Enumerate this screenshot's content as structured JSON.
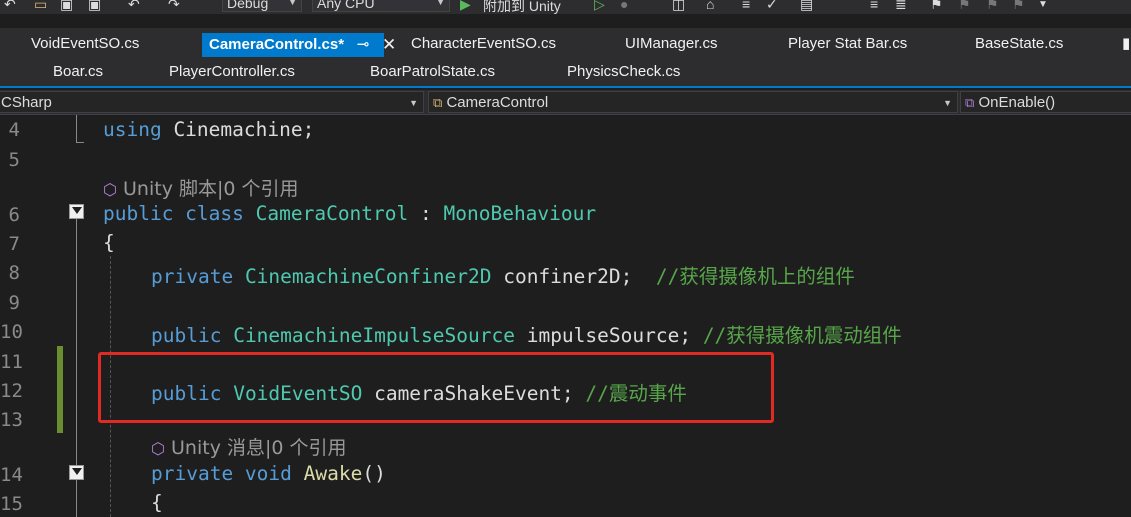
{
  "toolbar": {
    "config": "Debug",
    "platform": "Any CPU",
    "attach_label": "附加到 Unity"
  },
  "tabs": {
    "row1": [
      {
        "label": "VoidEventSO.cs"
      },
      {
        "label": "CameraControl.cs*",
        "active": true
      },
      {
        "label": "CharacterEventSO.cs"
      },
      {
        "label": "UIManager.cs"
      },
      {
        "label": "Player Stat Bar.cs"
      },
      {
        "label": "BaseState.cs"
      }
    ],
    "row2": [
      {
        "label": "Boar.cs"
      },
      {
        "label": "PlayerController.cs"
      },
      {
        "label": "BoarPatrolState.cs"
      },
      {
        "label": "PhysicsCheck.cs"
      }
    ]
  },
  "navbar": {
    "project": "CSharp",
    "class": "CameraControl",
    "member": "OnEnable()"
  },
  "code": {
    "line_numbers": [
      "4",
      "5",
      "6",
      "7",
      "8",
      "9",
      "10",
      "11",
      "12",
      "13",
      "14",
      "15"
    ],
    "l4": {
      "kw": "using",
      "rest": " Cinemachine;"
    },
    "lens1": "Unity 脚本|0 个引用",
    "l6": {
      "kw": "public class",
      "type": "CameraControl",
      "sep": " : ",
      "base": "MonoBehaviour"
    },
    "l7": "{",
    "l8": {
      "kw": "private",
      "type": "CinemachineConfiner2D",
      "name": " confiner2D;  ",
      "comment": "//获得摄像机上的组件"
    },
    "l10": {
      "kw": "public",
      "type": "CinemachineImpulseSource",
      "name": " impulseSource; ",
      "comment": "//获得摄像机震动组件"
    },
    "l12": {
      "kw": "public",
      "type": "VoidEventSO",
      "name": " cameraShakeEvent; ",
      "comment": "//震动事件"
    },
    "lens2": "Unity 消息|0 个引用",
    "l14": {
      "kw": "private void",
      "method": "Awake",
      "paren": "()"
    },
    "l15": "{"
  },
  "colors": {
    "keyword": "#569cd6",
    "type": "#4ec9b0",
    "comment": "#57a64a",
    "highlight": "#e02a24",
    "accent": "#007acc"
  }
}
